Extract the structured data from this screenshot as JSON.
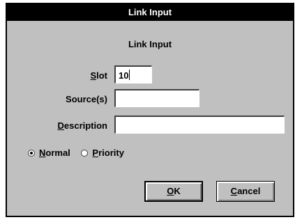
{
  "window": {
    "title": "Link Input"
  },
  "dialog": {
    "heading": "Link Input"
  },
  "fields": {
    "slot": {
      "label_hotkey": "S",
      "label_rest": "lot",
      "value": "10"
    },
    "sources": {
      "label": "Source(s)",
      "value": ""
    },
    "description": {
      "label_hotkey": "D",
      "label_rest": "escription",
      "value": ""
    }
  },
  "mode": {
    "normal": {
      "label_hotkey": "N",
      "label_rest": "ormal",
      "selected": true
    },
    "priority": {
      "label_hotkey": "P",
      "label_rest": "riority",
      "selected": false
    }
  },
  "buttons": {
    "ok": {
      "label_hotkey": "O",
      "label_rest": "K"
    },
    "cancel": {
      "label_hotkey": "C",
      "label_rest": "ancel"
    }
  }
}
